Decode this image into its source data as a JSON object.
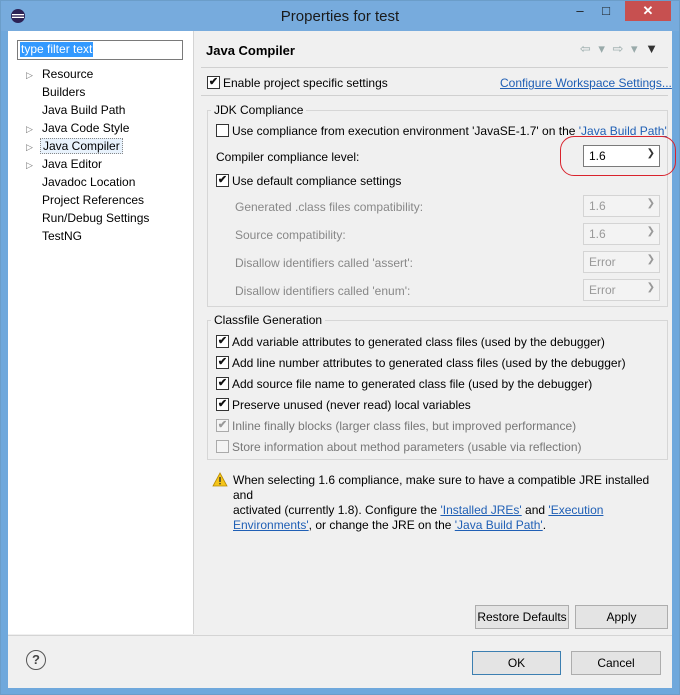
{
  "window": {
    "title": "Properties for test",
    "minimize_glyph": "–",
    "maximize_glyph": "□",
    "close_glyph": "✕",
    "app_icon": "eclipse-icon"
  },
  "sidebar": {
    "filter_placeholder": "type filter text",
    "items": [
      {
        "label": "Resource",
        "expandable": true
      },
      {
        "label": "Builders",
        "expandable": false
      },
      {
        "label": "Java Build Path",
        "expandable": false
      },
      {
        "label": "Java Code Style",
        "expandable": true
      },
      {
        "label": "Java Compiler",
        "expandable": true,
        "selected": true
      },
      {
        "label": "Java Editor",
        "expandable": true
      },
      {
        "label": "Javadoc Location",
        "expandable": false
      },
      {
        "label": "Project References",
        "expandable": false
      },
      {
        "label": "Run/Debug Settings",
        "expandable": false
      },
      {
        "label": "TestNG",
        "expandable": false
      }
    ]
  },
  "page": {
    "title": "Java Compiler",
    "nav_back": "⇦ ▾",
    "nav_forward": "⇨ ▾",
    "nav_menu": "▼",
    "enable_specific": "Enable project specific settings",
    "configure_link": "Configure Workspace Settings...",
    "jdk": {
      "title": "JDK Compliance",
      "use_exec_env_prefix": "Use compliance from execution environment 'JavaSE-1.7' on the ",
      "use_exec_env_link": "'Java Build Path'",
      "compliance_label": "Compiler compliance level:",
      "compliance_value": "1.6",
      "use_default": "Use default compliance settings",
      "generated_label": "Generated .class files compatibility:",
      "generated_value": "1.6",
      "source_label": "Source compatibility:",
      "source_value": "1.6",
      "assert_label": "Disallow identifiers called 'assert':",
      "assert_value": "Error",
      "enum_label": "Disallow identifiers called 'enum':",
      "enum_value": "Error"
    },
    "classfile": {
      "title": "Classfile Generation",
      "items": [
        {
          "label": "Add variable attributes to generated class files (used by the debugger)",
          "checked": true,
          "enabled": true
        },
        {
          "label": "Add line number attributes to generated class files (used by the debugger)",
          "checked": true,
          "enabled": true
        },
        {
          "label": "Add source file name to generated class file (used by the debugger)",
          "checked": true,
          "enabled": true
        },
        {
          "label": "Preserve unused (never read) local variables",
          "checked": true,
          "enabled": true
        },
        {
          "label": "Inline finally blocks (larger class files, but improved performance)",
          "checked": true,
          "enabled": false
        },
        {
          "label": "Store information about method parameters (usable via reflection)",
          "checked": false,
          "enabled": false
        }
      ]
    },
    "warning": {
      "line1": "When selecting 1.6 compliance, make sure to have a compatible JRE installed and",
      "line2_prefix": "activated (currently 1.8). Configure the ",
      "link_installed": "'Installed JREs'",
      "and": " and ",
      "link_exec_a": "'Execution",
      "link_exec_b": "Environments'",
      "line3_mid": ", or change the JRE on the ",
      "link_build": "'Java Build Path'",
      "line3_end": "."
    },
    "restore_defaults": "Restore Defaults",
    "apply": "Apply"
  },
  "footer": {
    "help_glyph": "?",
    "ok": "OK",
    "cancel": "Cancel"
  },
  "colors": {
    "title_bar": "#77abdd",
    "close_button": "#c75050",
    "highlight_ring": "#d9232d",
    "link": "#1f5fb5"
  }
}
